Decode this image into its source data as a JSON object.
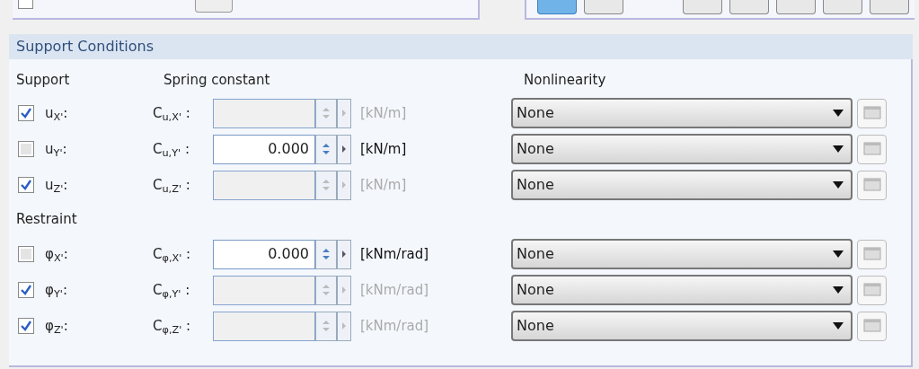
{
  "top_panel": {
    "checkbox_checked": false
  },
  "toolbar": [
    {
      "selected": true
    },
    {
      "selected": false
    },
    {
      "selected": false
    },
    {
      "selected": false
    },
    {
      "selected": false
    },
    {
      "selected": false
    },
    {
      "selected": false
    }
  ],
  "section": {
    "title": "Support Conditions",
    "support_header": "Support",
    "spring_header": "Spring constant",
    "nonlinearity_header": "Nonlinearity",
    "supports": [
      {
        "label": "u$_{X'}$:",
        "checked": true,
        "constant_label": "C$_{u,X'}$ :",
        "disabled": true,
        "unit": "[kN/m]",
        "nonlinearity": "None"
      },
      {
        "label": "u$_{Y'}$:",
        "checked": false,
        "constant_label": "C$_{u,Y'}$ :",
        "disabled": false,
        "value": "0.000",
        "unit": "[kN/m]",
        "nonlinearity": "None"
      },
      {
        "label": "u$_{Z'}$:",
        "checked": true,
        "constant_label": "C$_{u,Z'}$ :",
        "disabled": true,
        "unit": "[kN/m]",
        "nonlinearity": "None"
      }
    ],
    "restraint_header": "Restraint",
    "restraints": [
      {
        "label": "φ$_{X'}$:",
        "checked": false,
        "constant_label": "C$_{φ,X'}$ :",
        "disabled": false,
        "value": "0.000",
        "unit": "[kNm/rad]",
        "nonlinearity": "None"
      },
      {
        "label": "φ$_{Y'}$:",
        "checked": true,
        "constant_label": "C$_{φ,Y'}$ :",
        "disabled": true,
        "unit": "[kNm/rad]",
        "nonlinearity": "None"
      },
      {
        "label": "φ$_{Z'}$:",
        "checked": true,
        "constant_label": "C$_{φ,Z'}$ :",
        "disabled": true,
        "unit": "[kNm/rad]",
        "nonlinearity": "None"
      }
    ]
  }
}
